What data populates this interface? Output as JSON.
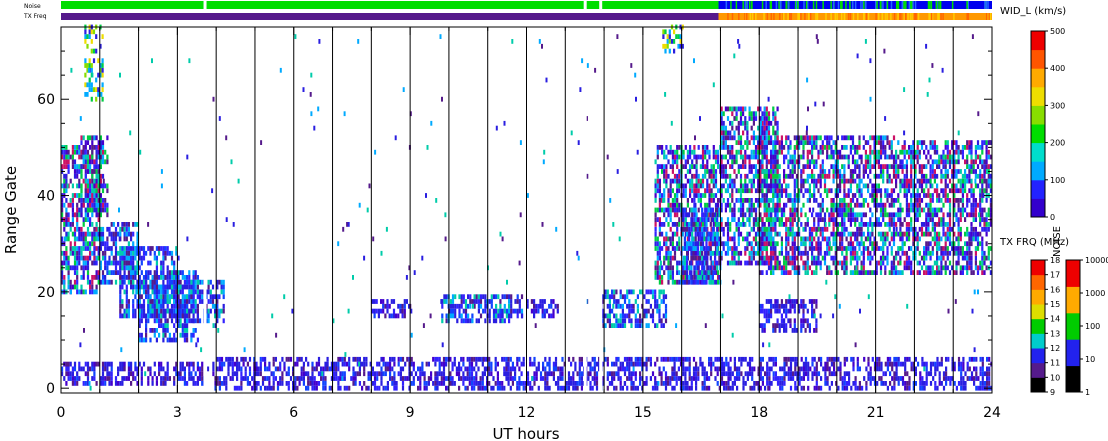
{
  "chart_data": {
    "type": "heatmap",
    "xlabel": "UT hours",
    "ylabel": "Range Gate",
    "xlim": [
      0,
      24
    ],
    "ylim": [
      -1,
      75
    ],
    "x_ticks": [
      "0",
      "3",
      "6",
      "9",
      "12",
      "15",
      "18",
      "21",
      "24"
    ],
    "y_ticks": [
      "0",
      "20",
      "40",
      "60"
    ],
    "grid": "vertical lines every hour",
    "scan_segments": [
      {
        "x0": 0.0,
        "x1": 1.0,
        "g0": 20,
        "g1": 50,
        "level": "high"
      },
      {
        "x0": 0.5,
        "x1": 1.2,
        "g0": 36,
        "g1": 52,
        "level": "high"
      },
      {
        "x0": 1.0,
        "x1": 2.0,
        "g0": 22,
        "g1": 34,
        "level": "mid"
      },
      {
        "x0": 1.5,
        "x1": 3.0,
        "g0": 15,
        "g1": 29,
        "level": "mid"
      },
      {
        "x0": 2.0,
        "x1": 3.5,
        "g0": 10,
        "g1": 24,
        "level": "mid"
      },
      {
        "x0": 3.0,
        "x1": 4.2,
        "g0": 14,
        "g1": 22,
        "level": "mid"
      },
      {
        "x0": 0.0,
        "x1": 3.7,
        "g0": 1,
        "g1": 5,
        "level": "low"
      },
      {
        "x0": 3.9,
        "x1": 24.0,
        "g0": 0,
        "g1": 6,
        "level": "low"
      },
      {
        "x0": 8.0,
        "x1": 9.0,
        "g0": 15,
        "g1": 18,
        "level": "low"
      },
      {
        "x0": 9.8,
        "x1": 11.9,
        "g0": 14,
        "g1": 19,
        "level": "mid"
      },
      {
        "x0": 12.0,
        "x1": 12.8,
        "g0": 15,
        "g1": 18,
        "level": "low"
      },
      {
        "x0": 13.9,
        "x1": 15.6,
        "g0": 13,
        "g1": 20,
        "level": "mid"
      },
      {
        "x0": 15.3,
        "x1": 17.0,
        "g0": 22,
        "g1": 50,
        "level": "high"
      },
      {
        "x0": 16.0,
        "x1": 17.0,
        "g0": 22,
        "g1": 37,
        "level": "mid"
      },
      {
        "x0": 17.0,
        "x1": 18.5,
        "g0": 26,
        "g1": 58,
        "level": "high"
      },
      {
        "x0": 18.0,
        "x1": 21.5,
        "g0": 24,
        "g1": 52,
        "level": "high"
      },
      {
        "x0": 21.5,
        "x1": 24.0,
        "g0": 24,
        "g1": 51,
        "level": "high"
      },
      {
        "x0": 18.0,
        "x1": 19.5,
        "g0": 12,
        "g1": 18,
        "level": "low"
      },
      {
        "x0": 0.6,
        "x1": 1.1,
        "g0": 60,
        "g1": 75,
        "level": "peak"
      },
      {
        "x0": 15.5,
        "x1": 16.0,
        "g0": 70,
        "g1": 75,
        "level": "peak"
      }
    ],
    "day_gaps": [
      3.7,
      13.5,
      13.9
    ],
    "noise_strip": [
      {
        "x0": 0.0,
        "x1": 16.95,
        "color": "#00dd00"
      },
      {
        "x0": 16.95,
        "x1": 24.0,
        "color": "#0000ee"
      }
    ],
    "txfreq_strip": [
      {
        "x0": 0.0,
        "x1": 16.95,
        "color": "#551a8b"
      },
      {
        "x0": 16.95,
        "x1": 24.0,
        "color": "#ff9900"
      }
    ]
  },
  "strips": {
    "noise_label": "Noise",
    "txfreq_label": "TX Freq"
  },
  "colorbars": {
    "width": {
      "title": "WID_L (km/s)",
      "ticks": [
        "500",
        "400",
        "300",
        "200",
        "100",
        "0"
      ],
      "colors": [
        "#3300cc",
        "#2222ff",
        "#00aaff",
        "#00ddcc",
        "#00dd00",
        "#88dd00",
        "#eedd00",
        "#ffaa00",
        "#ff5500",
        "#ee0000"
      ]
    },
    "txfreq": {
      "title": "TX FRQ (MHz)",
      "ticks": [
        "18",
        "17",
        "16",
        "15",
        "14",
        "13",
        "12",
        "11",
        "10",
        "9"
      ],
      "colors": [
        "#000000",
        "#551a8b",
        "#2222ee",
        "#00cccc",
        "#00cc00",
        "#dddd00",
        "#ffaa00",
        "#ff6600",
        "#ee0000"
      ]
    },
    "noise": {
      "title": "NOISE",
      "ticks": [
        "10000",
        "1000",
        "100",
        "10",
        "1"
      ],
      "colors": [
        "#000000",
        "#2222ee",
        "#00cc00",
        "#ffaa00",
        "#ee0000"
      ]
    }
  }
}
